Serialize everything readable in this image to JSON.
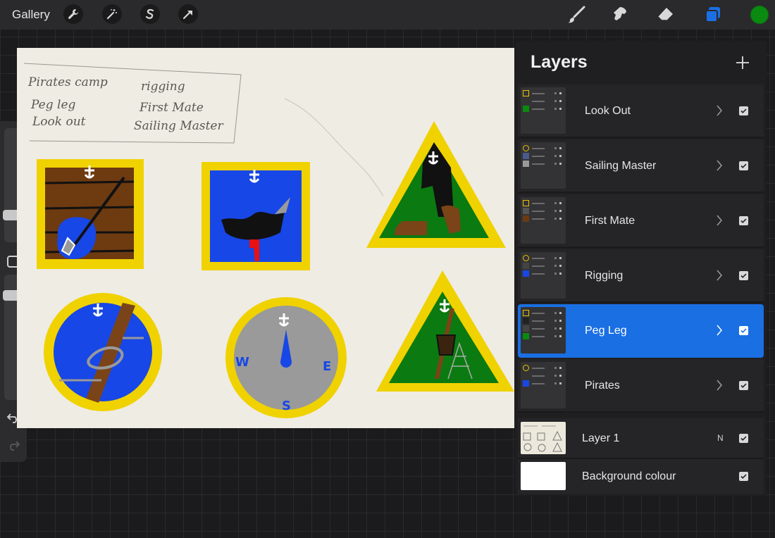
{
  "topbar": {
    "gallery_label": "Gallery",
    "left_tools": [
      "wrench-icon",
      "magic-wand-icon",
      "selection-s-icon",
      "transform-arrow-icon"
    ],
    "right_tools": [
      "brush-icon",
      "smudge-icon",
      "eraser-icon",
      "layers-icon"
    ],
    "active_color": "#0a8a10",
    "layers_icon_color": "#1a6fe3"
  },
  "sidebar": {
    "brush_size_level": 0.8,
    "opacity_level": 0.6
  },
  "layers_panel": {
    "title": "Layers",
    "add_button": "add-layer-icon",
    "groups": [
      {
        "name": "Look Out",
        "visible": true,
        "active": false,
        "thumb": [
          "#e8c400",
          "#333",
          "#0a8a10"
        ]
      },
      {
        "name": "Sailing Master",
        "visible": true,
        "active": false,
        "thumb": [
          "#e8c400",
          "#4a5a8a",
          "#9a9a9a"
        ]
      },
      {
        "name": "First Mate",
        "visible": true,
        "active": false,
        "thumb": [
          "#e8c400",
          "#555",
          "#6b3a12"
        ]
      },
      {
        "name": "Rigging",
        "visible": true,
        "active": false,
        "thumb": [
          "#e8c400",
          "#444",
          "#1747e6"
        ]
      },
      {
        "name": "Peg Leg",
        "visible": true,
        "active": true,
        "thumb": [
          "#e8c400",
          "#222",
          "#444",
          "#0a8a10"
        ]
      },
      {
        "name": "Pirates",
        "visible": true,
        "active": false,
        "thumb": [
          "#e8c400",
          "#333",
          "#1747e6"
        ]
      }
    ],
    "layer1": {
      "name": "Layer 1",
      "blend": "N",
      "visible": true
    },
    "background": {
      "name": "Background colour",
      "visible": true,
      "color": "#ffffff"
    }
  },
  "canvas": {
    "paper_color": "#efece4",
    "notes": {
      "col1": [
        "Pirates camp",
        "Peg leg",
        "Look out"
      ],
      "col2": [
        "rigging",
        "First Mate",
        "Sailing Master"
      ]
    },
    "compass_letters": {
      "w": "W",
      "e": "E",
      "s": "S"
    }
  }
}
